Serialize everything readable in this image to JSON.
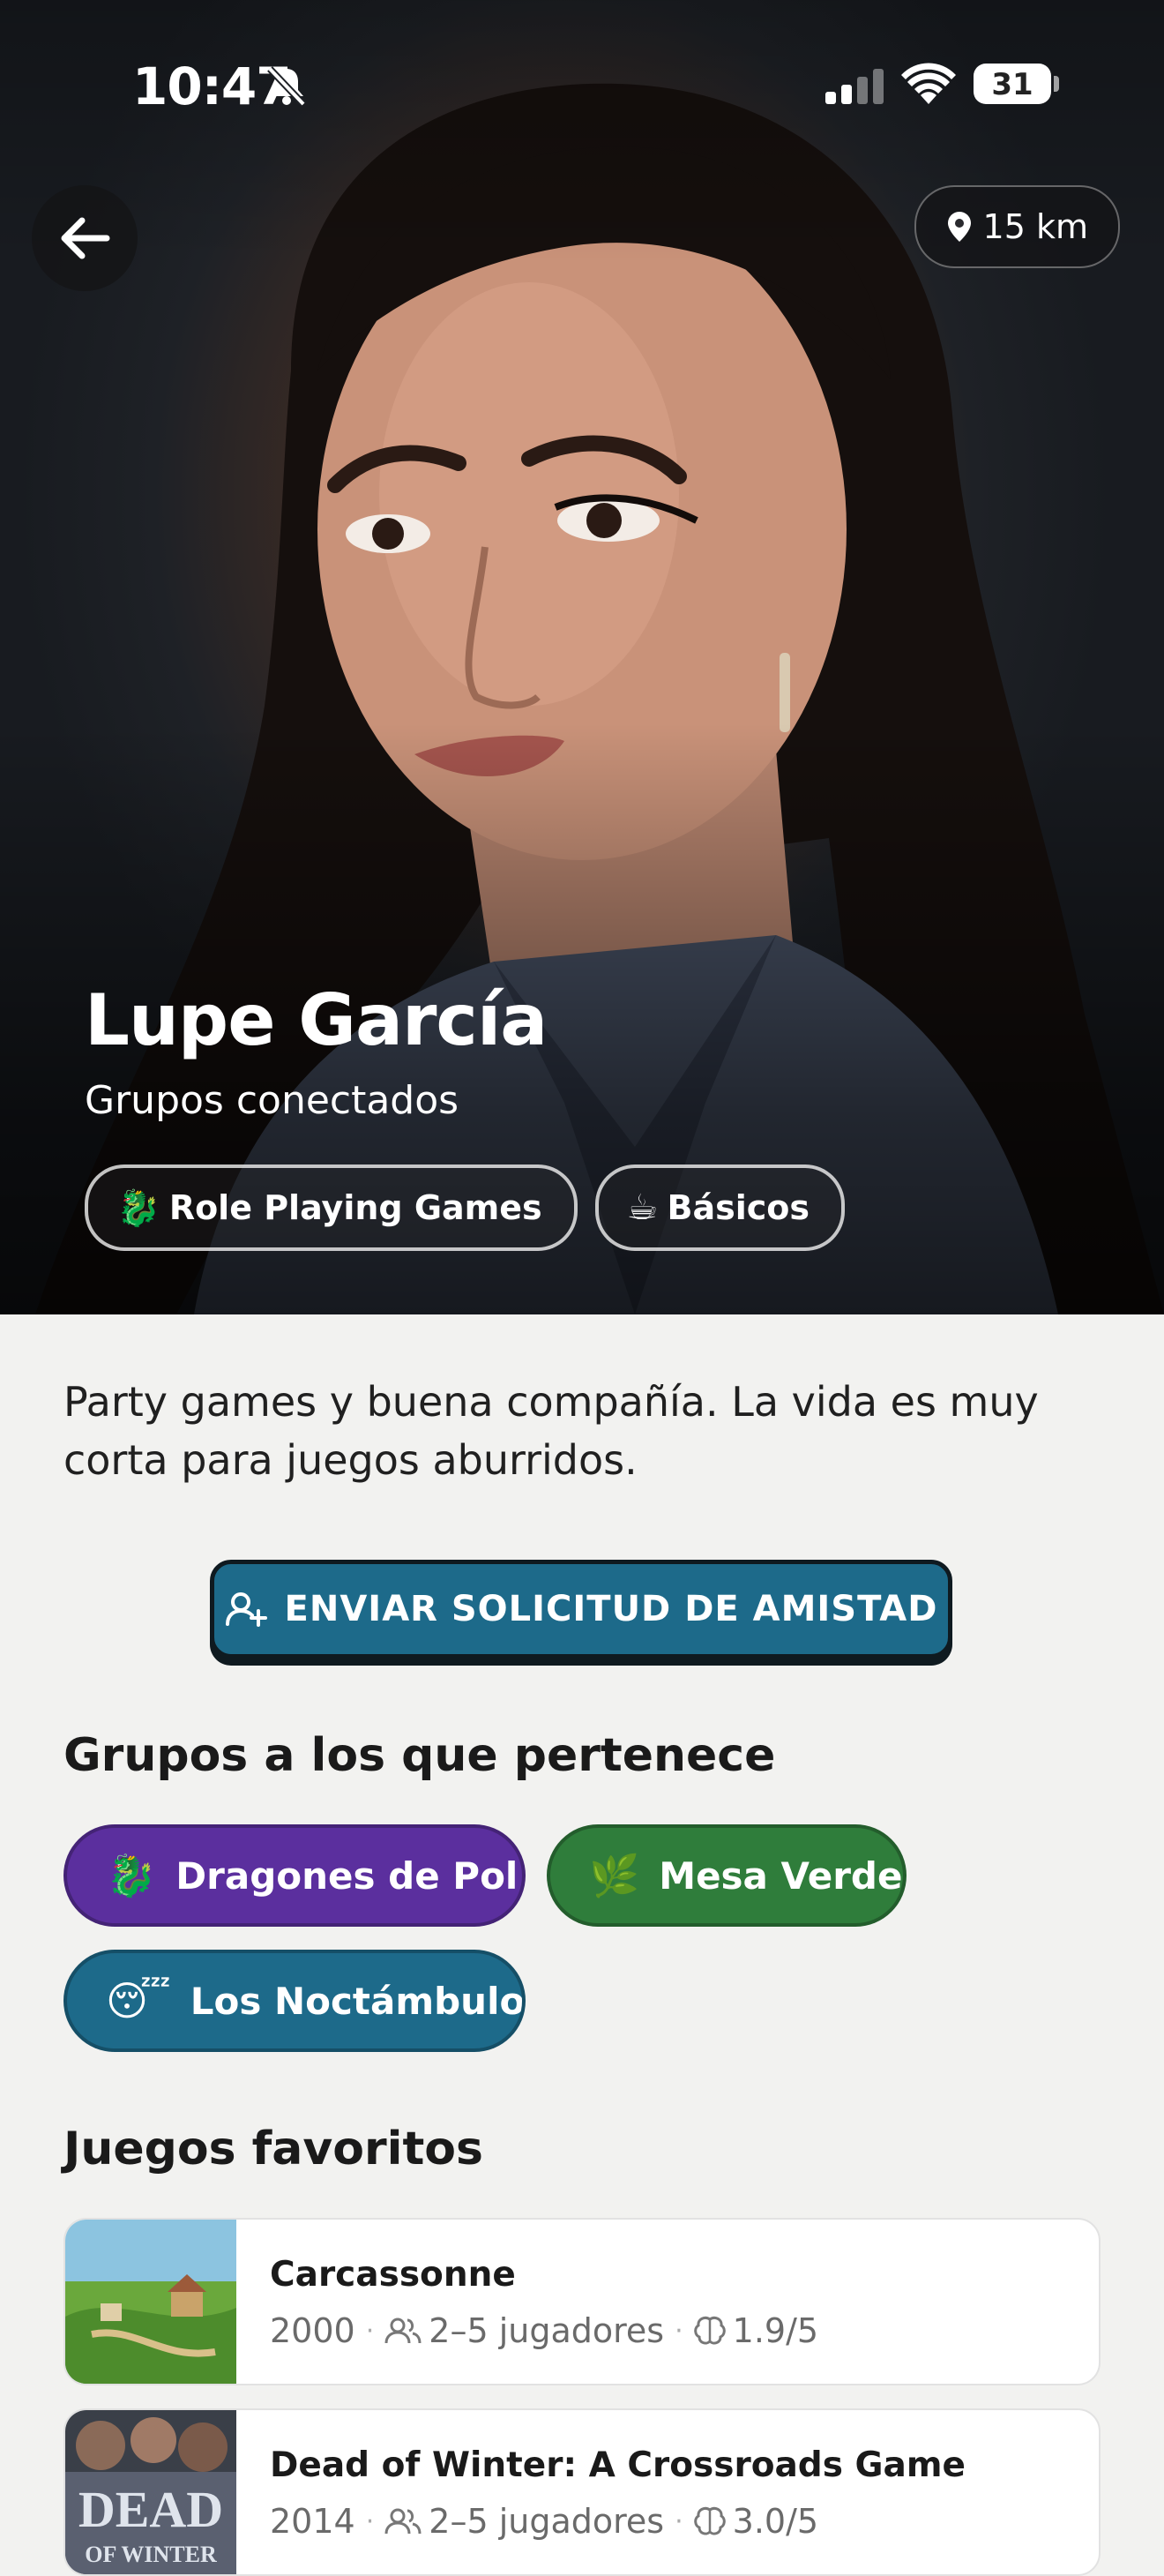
{
  "status": {
    "time": "10:47",
    "battery": "31"
  },
  "header": {
    "distance": "15 km"
  },
  "profile": {
    "name": "Lupe García",
    "subtitle": "Grupos conectados",
    "tags": [
      {
        "emoji": "🐉",
        "label": "Role Playing Games"
      },
      {
        "emoji": "☕",
        "label": "Básicos"
      }
    ],
    "bio": "Party games y buena compañía. La vida es muy corta para juegos aburridos.",
    "friend_button": "ENVIAR SOLICITUD DE AMISTAD"
  },
  "groups": {
    "title": "Grupos a los que pertenece",
    "items": [
      {
        "emoji": "🐉",
        "label": "Dragones de Pol...",
        "color": "#5b2f9e"
      },
      {
        "emoji": "🌿",
        "label": "Mesa Verde",
        "color": "#2f7d3b"
      },
      {
        "emoji": "😴",
        "label": "Los Noctámbulos",
        "color": "#1d6a8a"
      }
    ]
  },
  "games": {
    "title": "Juegos favoritos",
    "items": [
      {
        "title": "Carcassonne",
        "year": "2000",
        "players": "2–5 jugadores",
        "rating": "1.9/5"
      },
      {
        "title": "Dead of Winter: A Crossroads Game",
        "year": "2014",
        "players": "2–5 jugadores",
        "rating": "3.0/5"
      }
    ]
  }
}
